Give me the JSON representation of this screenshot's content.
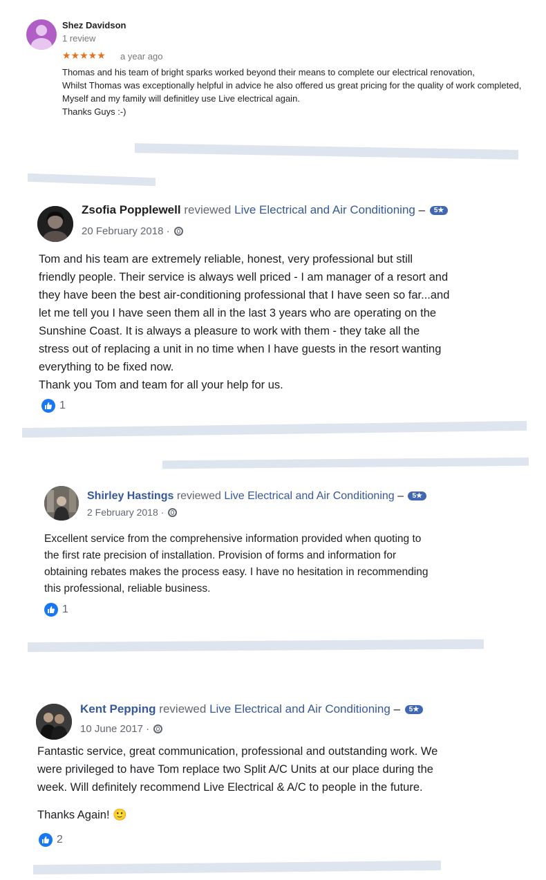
{
  "google_review": {
    "author": "Shez Davidson",
    "review_count": "1 review",
    "stars": "★★★★★",
    "time": "a year ago",
    "text": "Thomas and his team of bright sparks worked beyond their means to complete our electrical renovation,\nWhilst Thomas was exceptionally helpful in advice he also offered us great pricing for the quality of work completed,\nMyself and my family will definitley use Live electrical again.\nThanks Guys :-)"
  },
  "reviews": [
    {
      "author": "Zsofia Popplewell",
      "reviewed": "reviewed",
      "page": "Live Electrical and Air Conditioning",
      "dash": "–",
      "badge": "5★",
      "date": "20 February 2018 ·",
      "text": "Tom and his team are extremely reliable, honest, very professional but still\nfriendly people. Their service is always well priced - I am manager of a resort and\nthey have been the best air-conditioning professional that I have seen so far...and\nlet me tell you I have seen them all in the last 3 years who are operating on the\nSunshine Coast. It is always a pleasure to work with them - they take all the\nstress out of replacing a unit in no time when I have guests in the resort wanting\neverything to be fixed now.\nThank you Tom and team for all your help for us.",
      "likes": "1"
    },
    {
      "author": "Shirley Hastings",
      "reviewed": "reviewed",
      "page": "Live Electrical and Air Conditioning",
      "dash": "–",
      "badge": "5★",
      "date": "2 February 2018 ·",
      "text": "Excellent service from the comprehensive information provided when quoting to\nthe first rate precision of installation. Provision of forms and information for\nobtaining rebates makes the process easy. I have no hesitation in recommending\nthis professional, reliable business.",
      "likes": "1"
    },
    {
      "author": "Kent Pepping",
      "reviewed": "reviewed",
      "page": "Live Electrical and Air Conditioning",
      "dash": "–",
      "badge": "5★",
      "date": "10 June 2017 ·",
      "text": "Fantastic service, great communication, professional and outstanding work. We\nwere privileged to have Tom replace two Split A/C Units at our place during the\nweek. Will definitely recommend Live Electrical & A/C to people in the future.",
      "text2": "Thanks Again! 🙂",
      "likes": "2"
    }
  ],
  "colors": {
    "facebook_link": "#365899",
    "like_blue": "#1877f2",
    "star_orange": "#e7711b",
    "google_avatar": "#b05ec6"
  }
}
